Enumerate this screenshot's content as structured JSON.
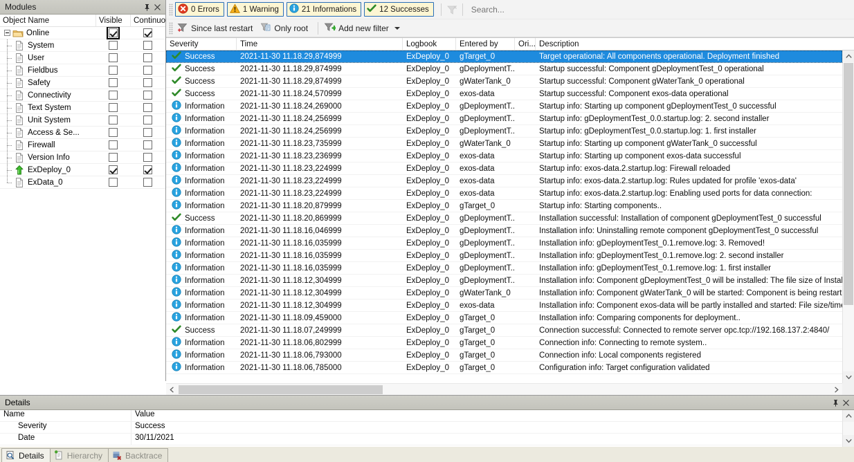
{
  "modules_panel": {
    "title": "Modules",
    "pin_tooltip": "Auto Hide",
    "close_tooltip": "Close",
    "columns": [
      "Object Name",
      "Visible",
      "Continuous"
    ],
    "root": {
      "label": "Online",
      "icon": "folder-icon",
      "visible": true,
      "continuous": true,
      "expanded": true
    },
    "items": [
      {
        "label": "System",
        "icon": "document-icon",
        "visible": false,
        "continuous": false
      },
      {
        "label": "User",
        "icon": "document-icon",
        "visible": false,
        "continuous": false
      },
      {
        "label": "Fieldbus",
        "icon": "document-icon",
        "visible": false,
        "continuous": false
      },
      {
        "label": "Safety",
        "icon": "document-icon",
        "visible": false,
        "continuous": false
      },
      {
        "label": "Connectivity",
        "icon": "document-icon",
        "visible": false,
        "continuous": false
      },
      {
        "label": "Text System",
        "icon": "document-icon",
        "visible": false,
        "continuous": false
      },
      {
        "label": "Unit System",
        "icon": "document-icon",
        "visible": false,
        "continuous": false
      },
      {
        "label": "Access & Se...",
        "icon": "document-icon",
        "visible": false,
        "continuous": false
      },
      {
        "label": "Firewall",
        "icon": "document-icon",
        "visible": false,
        "continuous": false
      },
      {
        "label": "Version Info",
        "icon": "document-icon",
        "visible": false,
        "continuous": false
      },
      {
        "label": "ExDeploy_0",
        "icon": "green-arrow-up-icon",
        "visible": true,
        "continuous": true
      },
      {
        "label": "ExData_0",
        "icon": "document-icon",
        "visible": false,
        "continuous": false
      }
    ]
  },
  "toolbar": {
    "severity_filters": [
      {
        "icon": "error-icon",
        "label": "0 Errors"
      },
      {
        "icon": "warning-icon",
        "label": "1 Warning"
      },
      {
        "icon": "information-icon",
        "label": "21 Informations"
      },
      {
        "icon": "success-icon",
        "label": "12 Successes"
      }
    ],
    "clear_filter_icon": "clear-filter-icon",
    "search": {
      "value": "",
      "placeholder": "Search..."
    }
  },
  "filter_bar": {
    "items": [
      {
        "icon": "since-last-restart-icon",
        "label": "Since last restart"
      },
      {
        "icon": "only-root-icon",
        "label": "Only root"
      }
    ],
    "add_filter": {
      "icon": "add-filter-icon",
      "label": "Add new filter"
    }
  },
  "grid": {
    "columns": [
      "Severity",
      "Time",
      "Logbook",
      "Entered by",
      "Ori...",
      "Description"
    ],
    "rows": [
      {
        "severity": "Success",
        "icon": "success-icon",
        "time": "2021-11-30 11.18.29,874999",
        "logbook": "ExDeploy_0",
        "entered_by": "gTarget_0",
        "origin": "",
        "description": "Target operational: All components operational. Deployment finished",
        "selected": true
      },
      {
        "severity": "Success",
        "icon": "success-icon",
        "time": "2021-11-30 11.18.29,874999",
        "logbook": "ExDeploy_0",
        "entered_by": "gDeploymentT...",
        "origin": "",
        "description": "Startup successful: Component gDeploymentTest_0 operational"
      },
      {
        "severity": "Success",
        "icon": "success-icon",
        "time": "2021-11-30 11.18.29,874999",
        "logbook": "ExDeploy_0",
        "entered_by": "gWaterTank_0",
        "origin": "",
        "description": "Startup successful: Component gWaterTank_0 operational"
      },
      {
        "severity": "Success",
        "icon": "success-icon",
        "time": "2021-11-30 11.18.24,570999",
        "logbook": "ExDeploy_0",
        "entered_by": "exos-data",
        "origin": "",
        "description": "Startup successful: Component exos-data operational"
      },
      {
        "severity": "Information",
        "icon": "information-icon",
        "time": "2021-11-30 11.18.24,269000",
        "logbook": "ExDeploy_0",
        "entered_by": "gDeploymentT...",
        "origin": "",
        "description": "Startup info: Starting up component gDeploymentTest_0 successful"
      },
      {
        "severity": "Information",
        "icon": "information-icon",
        "time": "2021-11-30 11.18.24,256999",
        "logbook": "ExDeploy_0",
        "entered_by": "gDeploymentT...",
        "origin": "",
        "description": "Startup info: gDeploymentTest_0.0.startup.log: 2. second installer"
      },
      {
        "severity": "Information",
        "icon": "information-icon",
        "time": "2021-11-30 11.18.24,256999",
        "logbook": "ExDeploy_0",
        "entered_by": "gDeploymentT...",
        "origin": "",
        "description": "Startup info: gDeploymentTest_0.0.startup.log: 1. first installer"
      },
      {
        "severity": "Information",
        "icon": "information-icon",
        "time": "2021-11-30 11.18.23,735999",
        "logbook": "ExDeploy_0",
        "entered_by": "gWaterTank_0",
        "origin": "",
        "description": "Startup info: Starting up component gWaterTank_0 successful"
      },
      {
        "severity": "Information",
        "icon": "information-icon",
        "time": "2021-11-30 11.18.23,236999",
        "logbook": "ExDeploy_0",
        "entered_by": "exos-data",
        "origin": "",
        "description": "Startup info: Starting up component exos-data successful"
      },
      {
        "severity": "Information",
        "icon": "information-icon",
        "time": "2021-11-30 11.18.23,224999",
        "logbook": "ExDeploy_0",
        "entered_by": "exos-data",
        "origin": "",
        "description": "Startup info: exos-data.2.startup.log: Firewall reloaded"
      },
      {
        "severity": "Information",
        "icon": "information-icon",
        "time": "2021-11-30 11.18.23,224999",
        "logbook": "ExDeploy_0",
        "entered_by": "exos-data",
        "origin": "",
        "description": "Startup info: exos-data.2.startup.log: Rules updated for profile 'exos-data'"
      },
      {
        "severity": "Information",
        "icon": "information-icon",
        "time": "2021-11-30 11.18.23,224999",
        "logbook": "ExDeploy_0",
        "entered_by": "exos-data",
        "origin": "",
        "description": "Startup info: exos-data.2.startup.log: Enabling used ports for data connection:"
      },
      {
        "severity": "Information",
        "icon": "information-icon",
        "time": "2021-11-30 11.18.20,879999",
        "logbook": "ExDeploy_0",
        "entered_by": "gTarget_0",
        "origin": "",
        "description": "Startup info: Starting components.."
      },
      {
        "severity": "Success",
        "icon": "success-icon",
        "time": "2021-11-30 11.18.20,869999",
        "logbook": "ExDeploy_0",
        "entered_by": "gDeploymentT...",
        "origin": "",
        "description": "Installation successful: Installation of component gDeploymentTest_0 successful"
      },
      {
        "severity": "Information",
        "icon": "information-icon",
        "time": "2021-11-30 11.18.16,046999",
        "logbook": "ExDeploy_0",
        "entered_by": "gDeploymentT...",
        "origin": "",
        "description": "Installation info: Uninstalling remote component gDeploymentTest_0 successful"
      },
      {
        "severity": "Information",
        "icon": "information-icon",
        "time": "2021-11-30 11.18.16,035999",
        "logbook": "ExDeploy_0",
        "entered_by": "gDeploymentT...",
        "origin": "",
        "description": "Installation info: gDeploymentTest_0.1.remove.log: 3. Removed!"
      },
      {
        "severity": "Information",
        "icon": "information-icon",
        "time": "2021-11-30 11.18.16,035999",
        "logbook": "ExDeploy_0",
        "entered_by": "gDeploymentT...",
        "origin": "",
        "description": "Installation info: gDeploymentTest_0.1.remove.log: 2. second installer"
      },
      {
        "severity": "Information",
        "icon": "information-icon",
        "time": "2021-11-30 11.18.16,035999",
        "logbook": "ExDeploy_0",
        "entered_by": "gDeploymentT...",
        "origin": "",
        "description": "Installation info: gDeploymentTest_0.1.remove.log: 1. first installer"
      },
      {
        "severity": "Information",
        "icon": "information-icon",
        "time": "2021-11-30 11.18.12,304999",
        "logbook": "ExDeploy_0",
        "entered_by": "gDeploymentT...",
        "origin": "",
        "description": "Installation info: Component gDeploymentTest_0 will be installed: The file size of Install.txt has chang"
      },
      {
        "severity": "Information",
        "icon": "information-icon",
        "time": "2021-11-30 11.18.12,304999",
        "logbook": "ExDeploy_0",
        "entered_by": "gWaterTank_0",
        "origin": "",
        "description": "Installation info: Component gWaterTank_0 will be started: Component is being restarted on the targ"
      },
      {
        "severity": "Information",
        "icon": "information-icon",
        "time": "2021-11-30 11.18.12,304999",
        "logbook": "ExDeploy_0",
        "entered_by": "exos-data",
        "origin": "",
        "description": "Installation info: Component exos-data will be partly installed and started: File size/timestamp of exos-"
      },
      {
        "severity": "Information",
        "icon": "information-icon",
        "time": "2021-11-30 11.18.09,459000",
        "logbook": "ExDeploy_0",
        "entered_by": "gTarget_0",
        "origin": "",
        "description": "Installation info: Comparing components for deployment.."
      },
      {
        "severity": "Success",
        "icon": "success-icon",
        "time": "2021-11-30 11.18.07,249999",
        "logbook": "ExDeploy_0",
        "entered_by": "gTarget_0",
        "origin": "",
        "description": "Connection successful: Connected to remote server opc.tcp://192.168.137.2:4840/"
      },
      {
        "severity": "Information",
        "icon": "information-icon",
        "time": "2021-11-30 11.18.06,802999",
        "logbook": "ExDeploy_0",
        "entered_by": "gTarget_0",
        "origin": "",
        "description": "Connection info: Connecting to remote system.."
      },
      {
        "severity": "Information",
        "icon": "information-icon",
        "time": "2021-11-30 11.18.06,793000",
        "logbook": "ExDeploy_0",
        "entered_by": "gTarget_0",
        "origin": "",
        "description": "Connection info: Local components registered"
      },
      {
        "severity": "Information",
        "icon": "information-icon",
        "time": "2021-11-30 11.18.06,785000",
        "logbook": "ExDeploy_0",
        "entered_by": "gTarget_0",
        "origin": "",
        "description": "Configuration info: Target configuration validated"
      }
    ]
  },
  "details_panel": {
    "title": "Details",
    "columns": [
      "Name",
      "Value"
    ],
    "rows": [
      {
        "name": "Severity",
        "value": "Success"
      },
      {
        "name": "Date",
        "value": "30/11/2021"
      }
    ]
  },
  "bottom_tabs": [
    {
      "label": "Details",
      "icon": "details-magnifier-icon",
      "active": true
    },
    {
      "label": "Hierarchy",
      "icon": "hierarchy-icon",
      "active": false
    },
    {
      "label": "Backtrace",
      "icon": "backtrace-icon",
      "active": false
    }
  ],
  "colors": {
    "selection_blue": "#1e8bde",
    "filter_border": "#2a6fb8",
    "filter_fill": "#fdf6d3",
    "error_red": "#e03a20",
    "warning_amber": "#f5ae18",
    "info_blue": "#29a3e0",
    "success_green": "#2f8a29",
    "caption_gray": "#c6c6bf"
  }
}
